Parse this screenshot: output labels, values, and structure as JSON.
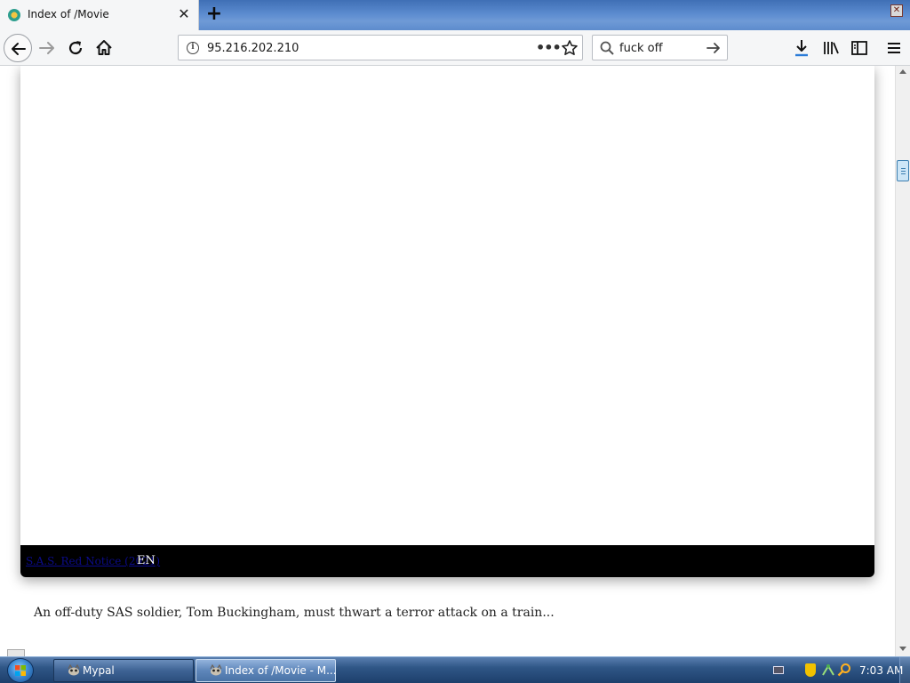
{
  "browser": {
    "tab": {
      "title": "Index of /Movie",
      "close_glyph": "✕"
    },
    "new_tab_glyph": "+",
    "window_close_glyph": "✕",
    "url": "95.216.202.210",
    "url_actions_glyph": "•••",
    "search": {
      "value": "fuck off"
    }
  },
  "page": {
    "player": {
      "link_text": "S.A.S. Red Notice (2021)",
      "language": "EN"
    },
    "description": "An off-duty SAS soldier, Tom Buckingham, must thwart a terror attack on a train..."
  },
  "taskbar": {
    "buttons": [
      {
        "label": "Mypal",
        "icon": "mypal-icon",
        "active": false
      },
      {
        "label": "Index of /Movie - M...",
        "icon": "mypal-icon",
        "active": true
      }
    ],
    "clock": "7:03 AM"
  },
  "colors": {
    "titlebar": "#5b8bcf",
    "toolbar": "#f5f6f7",
    "player_bar": "#000000",
    "player_link": "#0b0b8a",
    "taskbar": "#2f5686"
  }
}
